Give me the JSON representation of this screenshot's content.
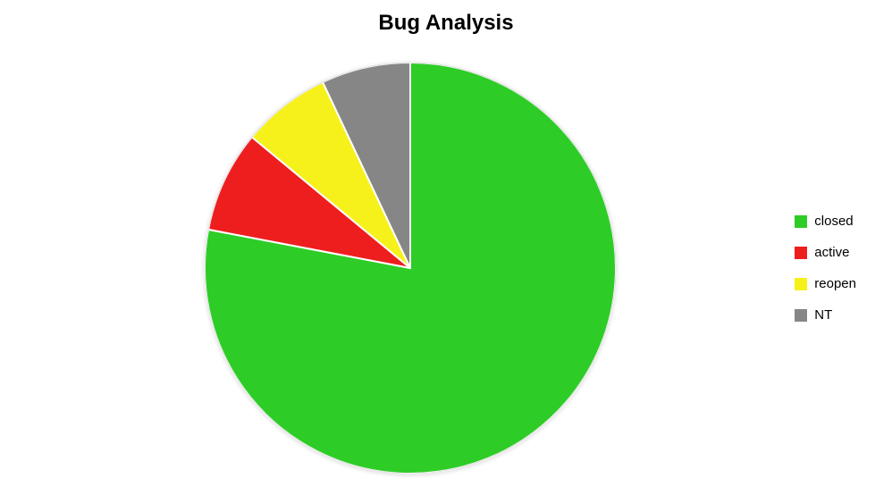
{
  "chart_data": {
    "type": "pie",
    "title": "Bug Analysis",
    "series": [
      {
        "name": "closed",
        "value": 78,
        "color": "#2ecc27"
      },
      {
        "name": "active",
        "value": 8,
        "color": "#ee1e1f"
      },
      {
        "name": "reopen",
        "value": 7,
        "color": "#f6f11a"
      },
      {
        "name": "NT",
        "value": 7,
        "color": "#878687"
      }
    ],
    "legend_position": "right"
  }
}
